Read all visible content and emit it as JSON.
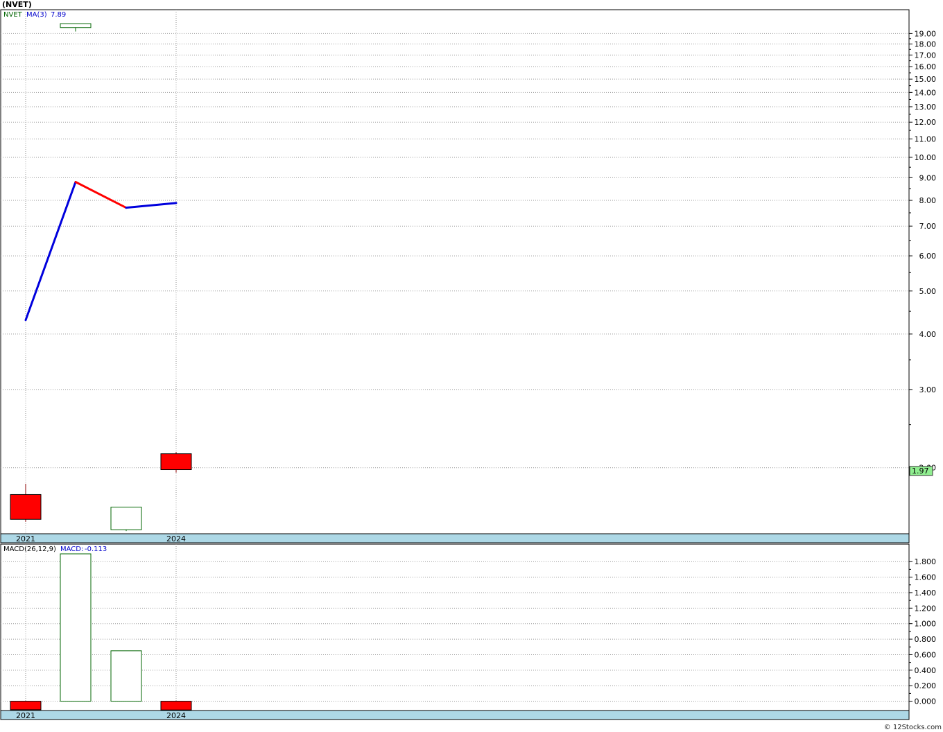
{
  "title": "(NVET)",
  "footer": "© 12Stocks.com",
  "colors": {
    "up": "#006400",
    "down": "#ff0000",
    "ma_up": "#0000dd",
    "ma_down": "#ff0000",
    "grid": "#999999",
    "dateband": "#add8e6",
    "last_price_bg": "#90ee90"
  },
  "chart_data": [
    {
      "type": "candlestick",
      "scale": "log",
      "ylim": [
        1.42,
        21.5
      ],
      "legend": {
        "ticker": "NVET",
        "ma_label": "MA(3)",
        "ma_value": "7.89"
      },
      "yticks": [
        "19.00",
        "18.00",
        "17.00",
        "16.00",
        "15.00",
        "14.00",
        "13.00",
        "12.00",
        "11.00",
        "10.00",
        "9.00",
        "8.00",
        "7.00",
        "6.00",
        "5.00",
        "4.00",
        "3.00",
        "2.00"
      ],
      "last_price": "1.97",
      "x_labels": [
        {
          "label": "2021",
          "index": 0
        },
        {
          "label": "2024",
          "index": 3
        }
      ],
      "candles": [
        {
          "open": 1.74,
          "high": 1.84,
          "low": 1.51,
          "close": 1.53
        },
        {
          "open": 19.6,
          "high": 20.0,
          "low": 19.2,
          "close": 20.0
        },
        {
          "open": 1.45,
          "high": 1.63,
          "low": 1.44,
          "close": 1.63
        },
        {
          "open": 2.15,
          "high": 2.17,
          "low": 1.95,
          "close": 1.98
        }
      ],
      "ma": [
        4.3,
        8.8,
        7.7,
        7.89
      ]
    },
    {
      "type": "bar",
      "title": "MACD(26,12,9)",
      "legend": {
        "label": "MACD:",
        "value": "-0.113"
      },
      "ylim": [
        -0.12,
        1.9
      ],
      "yticks": [
        "1.800",
        "1.600",
        "1.400",
        "1.200",
        "1.000",
        "0.800",
        "0.600",
        "0.400",
        "0.200",
        "0.000"
      ],
      "x_labels": [
        {
          "label": "2021",
          "index": 0
        },
        {
          "label": "2024",
          "index": 3
        }
      ],
      "values": [
        -0.11,
        1.9,
        0.65,
        -0.113
      ]
    }
  ]
}
